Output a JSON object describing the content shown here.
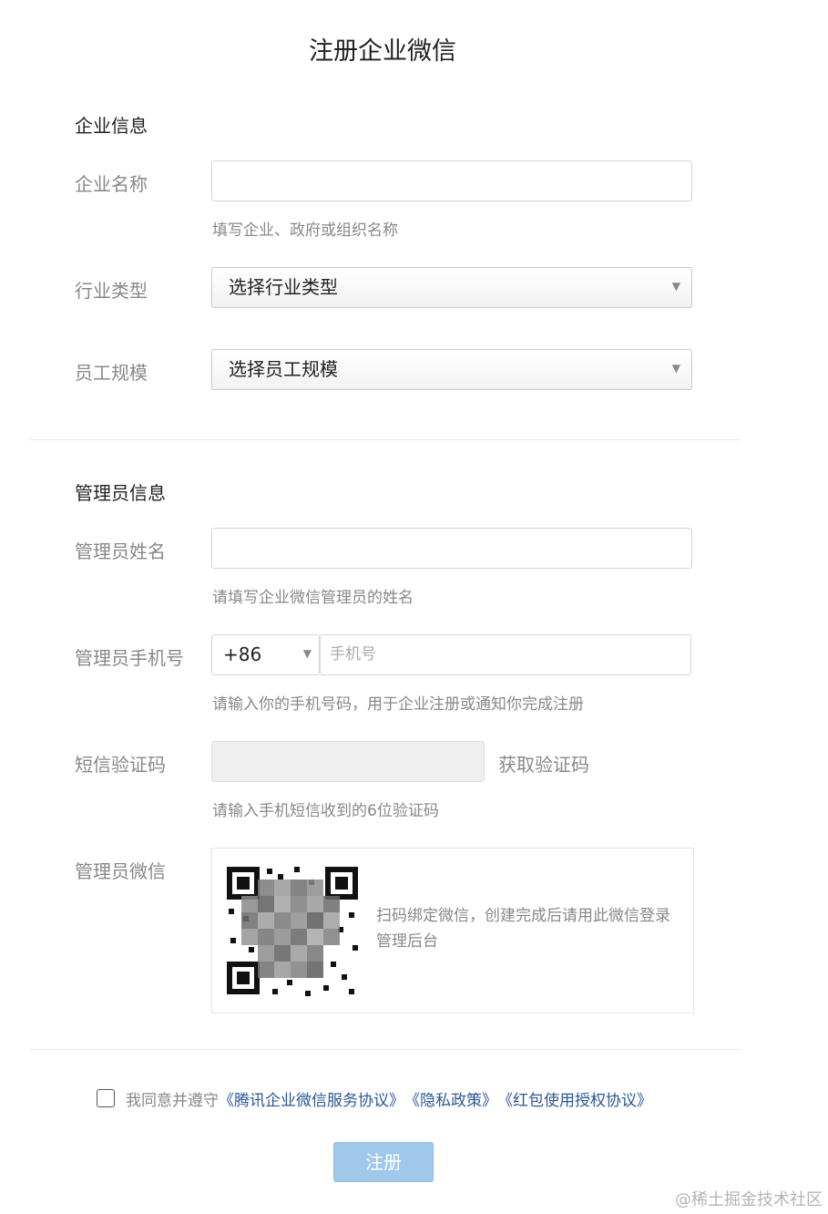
{
  "title": "注册企业微信",
  "company": {
    "section_title": "企业信息",
    "name_label": "企业名称",
    "name_value": "",
    "name_hint": "填写企业、政府或组织名称",
    "industry_label": "行业类型",
    "industry_selected": "选择行业类型",
    "size_label": "员工规模",
    "size_selected": "选择员工规模"
  },
  "admin": {
    "section_title": "管理员信息",
    "name_label": "管理员姓名",
    "name_value": "",
    "name_hint": "请填写企业微信管理员的姓名",
    "phone_label": "管理员手机号",
    "country_code": "+86",
    "phone_placeholder": "手机号",
    "phone_hint": "请输入你的手机号码，用于企业注册或通知你完成注册",
    "sms_label": "短信验证码",
    "get_code_label": "获取验证码",
    "sms_hint": "请输入手机短信收到的6位验证码",
    "wechat_label": "管理员微信",
    "qr_desc": "扫码绑定微信，创建完成后请用此微信登录管理后台"
  },
  "agreement": {
    "prefix": "我同意并遵守",
    "link_service": "《腾讯企业微信服务协议》",
    "link_privacy": "《隐私政策》",
    "link_redpacket": "《红包使用授权协议》",
    "checked": false
  },
  "register_label": "注册",
  "watermark": "@稀土掘金技术社区",
  "colors": {
    "link": "#2b5797",
    "button_disabled": "#9fc8ea",
    "label_gray": "#888888"
  },
  "icons": {
    "dropdown": "triangle-down",
    "qr_code": "qr-code-blurred"
  }
}
